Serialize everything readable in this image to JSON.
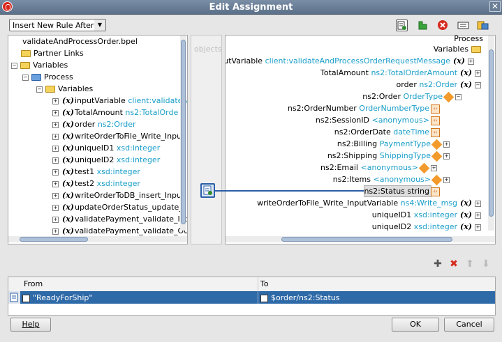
{
  "window": {
    "title": "Edit Assignment"
  },
  "toolbar": {
    "rule_dropdown": "Insert New Rule After",
    "icons": [
      "expression-icon",
      "xml-fragment-icon",
      "delete-icon",
      "literal-icon",
      "bulk-copy-icon"
    ]
  },
  "left_tree": {
    "rows": [
      {
        "name": "validateAndProcessOrder.bpel",
        "type": ""
      },
      {
        "name": "Partner Links",
        "type": ""
      },
      {
        "name": "Variables",
        "type": ""
      },
      {
        "name": "Process",
        "type": ""
      },
      {
        "name": "Variables",
        "type": ""
      },
      {
        "name": "inputVariable",
        "type": "client:validateA"
      },
      {
        "name": "TotalAmount",
        "type": "ns2:TotalOrde"
      },
      {
        "name": "order",
        "type": "ns2:Order"
      },
      {
        "name": "writeOrderToFile_Write_Inpu",
        "type": ""
      },
      {
        "name": "uniqueID1",
        "type": "xsd:integer"
      },
      {
        "name": "uniqueID2",
        "type": "xsd:integer"
      },
      {
        "name": "test1",
        "type": "xsd:integer"
      },
      {
        "name": "test2",
        "type": "xsd:integer"
      },
      {
        "name": "writeOrderToDB_insert_Inpu",
        "type": ""
      },
      {
        "name": "updateOrderStatus_update_",
        "type": ""
      },
      {
        "name": "validatePayment_validate_Inp",
        "type": ""
      },
      {
        "name": "validatePayment_validate_Ou",
        "type": ""
      }
    ]
  },
  "middle": {
    "label": "objects"
  },
  "right_tree": {
    "rows": [
      {
        "name": "Process",
        "type": ""
      },
      {
        "name": "Variables",
        "type": ""
      },
      {
        "name": "nputVariable",
        "type": "client:validateAndProcessOrderRequestMessage"
      },
      {
        "name": "TotalAmount",
        "type": "ns2:TotalOrderAmount"
      },
      {
        "name": "order",
        "type": "ns2:Order"
      },
      {
        "name": "ns2:Order",
        "type": "OrderType"
      },
      {
        "name": "ns2:OrderNumber",
        "type": "OrderNumberType"
      },
      {
        "name": "ns2:SessionID",
        "type": "<anonymous>"
      },
      {
        "name": "ns2:OrderDate",
        "type": "dateTime"
      },
      {
        "name": "ns2:Billing",
        "type": "PaymentType"
      },
      {
        "name": "ns2:Shipping",
        "type": "ShippingType"
      },
      {
        "name": "ns2:Email",
        "type": "<anonymous>"
      },
      {
        "name": "ns2:Items",
        "type": "<anonymous>"
      },
      {
        "name": "ns2:Status",
        "type": "string"
      },
      {
        "name": "writeOrderToFile_Write_InputVariable",
        "type": "ns4:Write_msg"
      },
      {
        "name": "uniqueID1",
        "type": "xsd:integer"
      },
      {
        "name": "uniqueID2",
        "type": "xsd:integer"
      }
    ]
  },
  "rules_table": {
    "headers": [
      "From",
      "To"
    ],
    "rows": [
      {
        "from": "\"ReadyForShip\"",
        "to": "$order/ns2:Status"
      }
    ]
  },
  "buttons": {
    "help": "Help",
    "ok": "OK",
    "cancel": "Cancel"
  }
}
